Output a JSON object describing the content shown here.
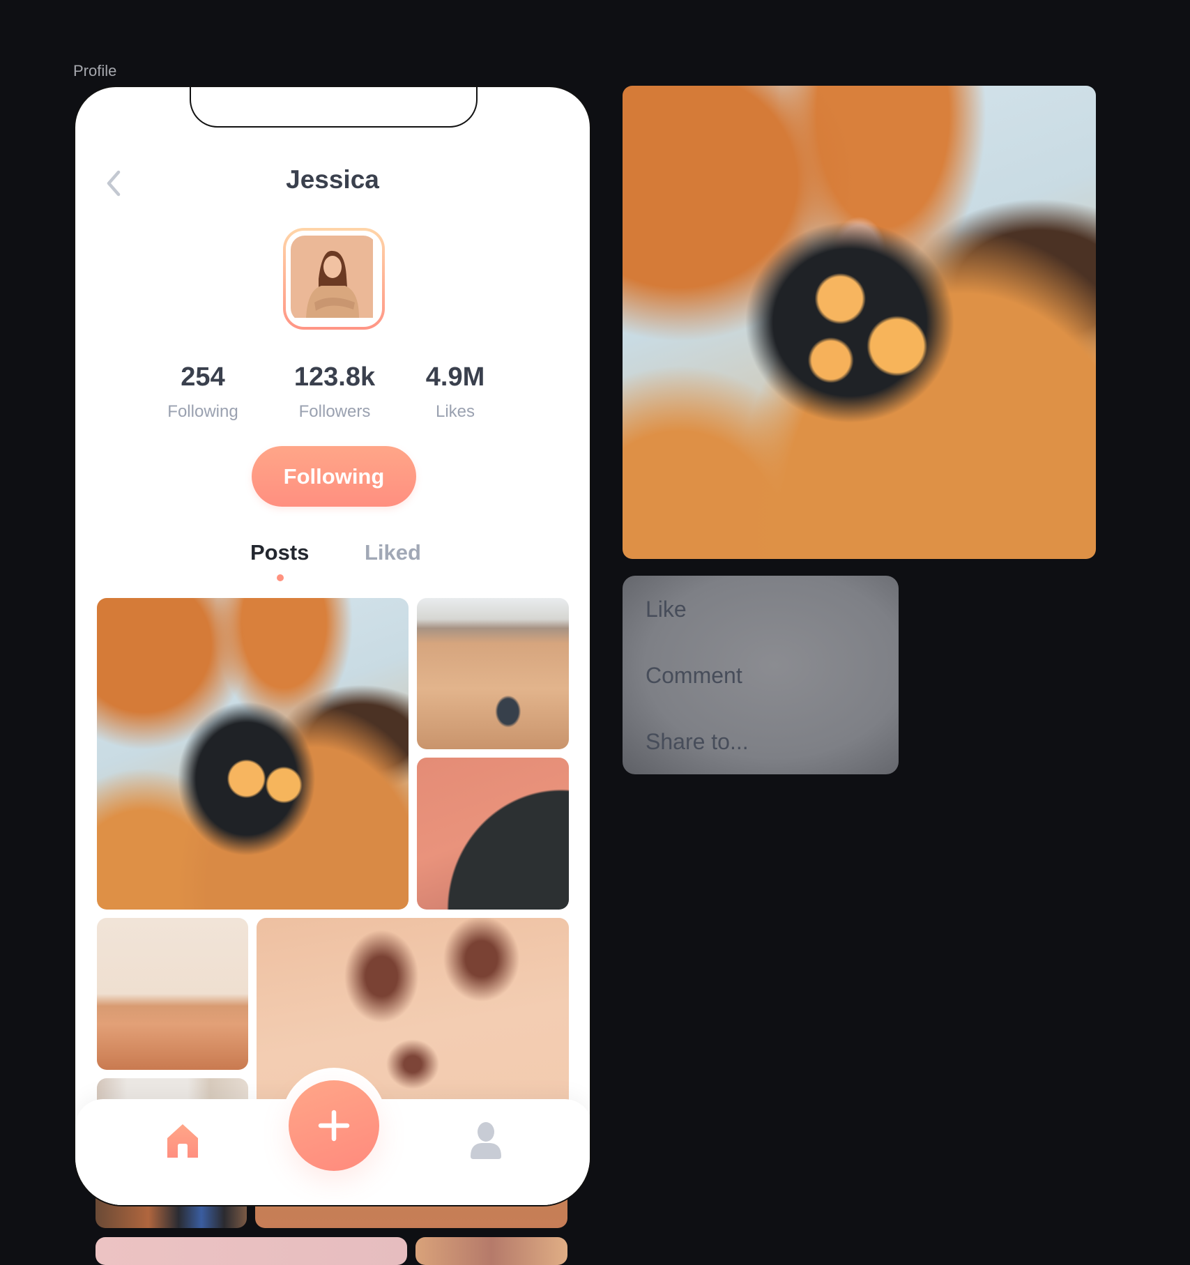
{
  "frame_label": "Profile",
  "header": {
    "title": "Jessica",
    "back_icon": "chevron-left-icon"
  },
  "profile": {
    "avatar_alt": "Jessica avatar",
    "stats": [
      {
        "value": "254",
        "label": "Following"
      },
      {
        "value": "123.8k",
        "label": "Followers"
      },
      {
        "value": "4.9M",
        "label": "Likes"
      }
    ],
    "follow_button_label": "Following"
  },
  "tabs": [
    {
      "label": "Posts",
      "active": true
    },
    {
      "label": "Liked",
      "active": false
    }
  ],
  "posts": [
    {
      "subject": "woman with orange flowers under tree"
    },
    {
      "subject": "hiker in desert canyon"
    },
    {
      "subject": "coral brick arch"
    },
    {
      "subject": "desert dunes landscape"
    },
    {
      "subject": "sand dune closeup"
    },
    {
      "subject": "city buildings"
    }
  ],
  "bottom_nav": {
    "items": [
      {
        "icon": "home-icon",
        "active": true
      },
      {
        "icon": "plus-icon",
        "active": false
      },
      {
        "icon": "user-icon",
        "active": false
      }
    ]
  },
  "preview": {
    "subject": "woman with orange flowers under tree"
  },
  "context_menu": {
    "items": [
      "Like",
      "Comment",
      "Share to..."
    ]
  },
  "colors": {
    "accent": "#ff927f",
    "accent_light": "#ffa688",
    "text_dark": "#3a404d",
    "text_muted": "#9aa1b0",
    "background": "#0e0f13"
  }
}
